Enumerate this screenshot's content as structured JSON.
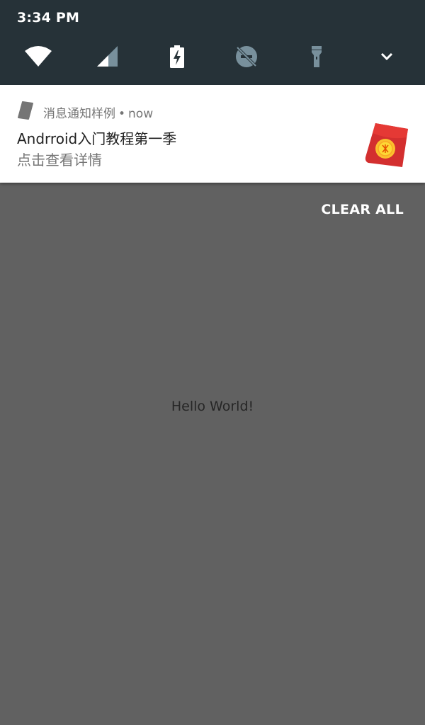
{
  "status_bar": {
    "time": "3:34 PM"
  },
  "quick_settings": [
    {
      "icon": "wifi-icon",
      "state": "on"
    },
    {
      "icon": "cellular-signal-icon",
      "state": "partial"
    },
    {
      "icon": "battery-charging-icon",
      "state": "charging"
    },
    {
      "icon": "do-not-disturb-off-icon",
      "state": "off"
    },
    {
      "icon": "flashlight-icon",
      "state": "off"
    },
    {
      "icon": "chevron-down-icon",
      "state": "expand"
    }
  ],
  "notification": {
    "app_name": "消息通知样例",
    "separator": "•",
    "time": "now",
    "title": "Andrroid入门教程第一季",
    "text": "点击查看详情",
    "large_icon": "red-envelope-icon"
  },
  "clear_all_label": "CLEAR ALL",
  "app_content": {
    "hello_text": "Hello World!"
  },
  "colors": {
    "shade_background": "#263238",
    "app_background": "#616161",
    "notification_background": "#ffffff",
    "envelope_red": "#d32f2f",
    "coin_gold": "#fbc02d"
  }
}
